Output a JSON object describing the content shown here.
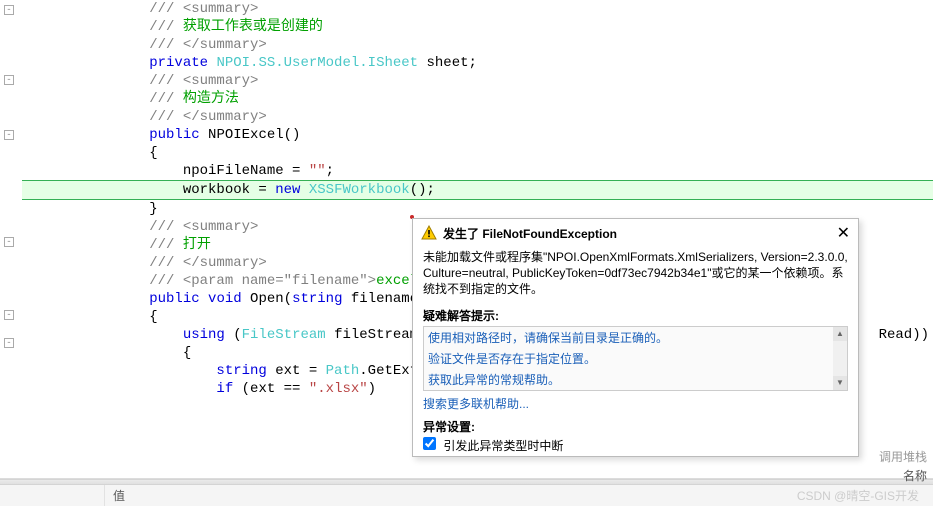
{
  "code": {
    "lines": [
      {
        "indent": 2,
        "tokens": [
          {
            "t": "cmt",
            "v": "/// <summary>"
          }
        ]
      },
      {
        "indent": 2,
        "tokens": [
          {
            "t": "cmt",
            "v": "/// "
          },
          {
            "t": "cmt-zh",
            "v": "获取工作表或是创建的"
          }
        ]
      },
      {
        "indent": 2,
        "tokens": [
          {
            "t": "cmt",
            "v": "/// </summary>"
          }
        ]
      },
      {
        "indent": 2,
        "tokens": [
          {
            "t": "kw",
            "v": "private"
          },
          {
            "t": "plain",
            "v": " "
          },
          {
            "t": "type",
            "v": "NPOI.SS.UserModel."
          },
          {
            "t": "type",
            "v": "ISheet"
          },
          {
            "t": "plain",
            "v": " sheet;"
          }
        ]
      },
      {
        "indent": 2,
        "tokens": [
          {
            "t": "cmt",
            "v": "/// <summary>"
          }
        ]
      },
      {
        "indent": 2,
        "tokens": [
          {
            "t": "cmt",
            "v": "/// "
          },
          {
            "t": "cmt-zh",
            "v": "构造方法"
          }
        ]
      },
      {
        "indent": 2,
        "tokens": [
          {
            "t": "cmt",
            "v": "/// </summary>"
          }
        ]
      },
      {
        "indent": 2,
        "tokens": [
          {
            "t": "kw",
            "v": "public"
          },
          {
            "t": "plain",
            "v": " NPOIExcel()"
          }
        ]
      },
      {
        "indent": 2,
        "tokens": [
          {
            "t": "curly",
            "v": "{"
          }
        ]
      },
      {
        "indent": 3,
        "tokens": [
          {
            "t": "plain",
            "v": "npoiFileName = "
          },
          {
            "t": "str",
            "v": "\"\""
          },
          {
            "t": "plain",
            "v": ";"
          }
        ]
      },
      {
        "indent": 3,
        "hl": true,
        "tokens": [
          {
            "t": "plain",
            "v": "workbook = "
          },
          {
            "t": "kw",
            "v": "new"
          },
          {
            "t": "plain",
            "v": " "
          },
          {
            "t": "type",
            "v": "XSSFWorkbook"
          },
          {
            "t": "plain",
            "v": "();"
          }
        ]
      },
      {
        "indent": 2,
        "tokens": [
          {
            "t": "curly",
            "v": "}"
          }
        ]
      },
      {
        "indent": 2,
        "tokens": [
          {
            "t": "cmt",
            "v": "/// <summary>"
          }
        ]
      },
      {
        "indent": 2,
        "tokens": [
          {
            "t": "cmt",
            "v": "/// "
          },
          {
            "t": "cmt-zh",
            "v": "打开"
          }
        ]
      },
      {
        "indent": 2,
        "tokens": [
          {
            "t": "cmt",
            "v": "/// </summary>"
          }
        ]
      },
      {
        "indent": 2,
        "tokens": [
          {
            "t": "cmt",
            "v": "/// <param name=\"filename\">"
          },
          {
            "t": "cmt-zh",
            "v": "excel文件"
          }
        ]
      },
      {
        "indent": 2,
        "tokens": [
          {
            "t": "kw",
            "v": "public"
          },
          {
            "t": "plain",
            "v": " "
          },
          {
            "t": "kw",
            "v": "void"
          },
          {
            "t": "plain",
            "v": " Open("
          },
          {
            "t": "kw",
            "v": "string"
          },
          {
            "t": "plain",
            "v": " filename)"
          }
        ]
      },
      {
        "indent": 2,
        "tokens": [
          {
            "t": "curly",
            "v": "{"
          }
        ]
      },
      {
        "indent": 3,
        "tokens": [
          {
            "t": "kw",
            "v": "using"
          },
          {
            "t": "plain",
            "v": " ("
          },
          {
            "t": "type",
            "v": "FileStream"
          },
          {
            "t": "plain",
            "v": " fileStream = "
          }
        ],
        "tail": " Read))"
      },
      {
        "indent": 3,
        "tokens": [
          {
            "t": "curly",
            "v": "{"
          }
        ]
      },
      {
        "indent": 4,
        "tokens": [
          {
            "t": "kw",
            "v": "string"
          },
          {
            "t": "plain",
            "v": " ext = "
          },
          {
            "t": "type",
            "v": "Path"
          },
          {
            "t": "plain",
            "v": ".GetExtens"
          }
        ]
      },
      {
        "indent": 4,
        "tokens": [
          {
            "t": "kw",
            "v": "if"
          },
          {
            "t": "plain",
            "v": " (ext == "
          },
          {
            "t": "str",
            "v": "\".xlsx\""
          },
          {
            "t": "plain",
            "v": ")"
          }
        ]
      },
      {
        "indent": 4,
        "tokens": [
          {
            "t": "plain",
            "v": ""
          }
        ]
      }
    ],
    "fold_positions": [
      5,
      75,
      130,
      237,
      310,
      338
    ]
  },
  "popup": {
    "title": "发生了 FileNotFoundException",
    "body": "未能加载文件或程序集\"NPOI.OpenXmlFormats.XmlSerializers, Version=2.3.0.0, Culture=neutral, PublicKeyToken=0df73ec7942b34e1\"或它的某一个依赖项。系统找不到指定的文件。",
    "hints_label": "疑难解答提示:",
    "links": [
      "使用相对路径时，请确保当前目录是正确的。",
      "验证文件是否存在于指定位置。",
      "获取此异常的常规帮助。"
    ],
    "search_more": "搜索更多联机帮助...",
    "settings_label": "异常设置:",
    "checkbox_label": "引发此异常类型时中断"
  },
  "bottom": {
    "col_value": "值",
    "col_name": "名称",
    "call_stack": "调用堆栈"
  },
  "watermark": "CSDN @晴空-GIS开发"
}
